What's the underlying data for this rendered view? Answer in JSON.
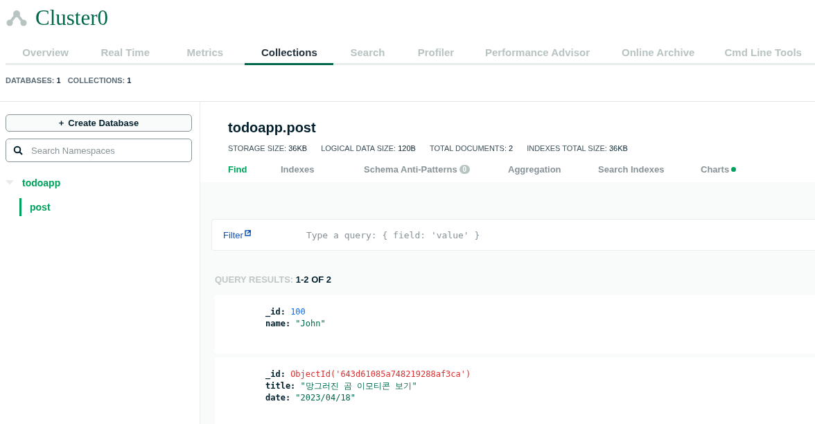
{
  "cluster": {
    "title": "Cluster0"
  },
  "tabs": [
    {
      "label": "Overview",
      "selected": false
    },
    {
      "label": "Real Time",
      "selected": false
    },
    {
      "label": "Metrics",
      "selected": false
    },
    {
      "label": "Collections",
      "selected": true
    },
    {
      "label": "Search",
      "selected": false
    },
    {
      "label": "Profiler",
      "selected": false
    },
    {
      "label": "Performance Advisor",
      "selected": false
    },
    {
      "label": "Online Archive",
      "selected": false
    },
    {
      "label": "Cmd Line Tools",
      "selected": false
    }
  ],
  "counts": [
    {
      "label": "DATABASES:",
      "value": "1"
    },
    {
      "label": "COLLECTIONS:",
      "value": "1"
    }
  ],
  "sidebar": {
    "create_button": {
      "icon": "+",
      "label": "Create Database"
    },
    "search": {
      "placeholder": "Search Namespaces"
    },
    "tree": [
      {
        "label": "todoapp",
        "expanded": true,
        "children": [
          {
            "label": "post",
            "selected": true
          }
        ]
      }
    ]
  },
  "collection": {
    "title": "todoapp.post",
    "stats": [
      {
        "label": "STORAGE SIZE:",
        "value": "36KB"
      },
      {
        "label": "LOGICAL DATA SIZE:",
        "value": "120B"
      },
      {
        "label": "TOTAL DOCUMENTS:",
        "value": "2"
      },
      {
        "label": "INDEXES TOTAL SIZE:",
        "value": "36KB"
      }
    ],
    "tabs": [
      {
        "label": "Find",
        "selected": true
      },
      {
        "label": "Indexes",
        "selected": false
      },
      {
        "label": "Schema Anti-Patterns",
        "selected": false,
        "badge": "0"
      },
      {
        "label": "Aggregation",
        "selected": false
      },
      {
        "label": "Search Indexes",
        "selected": false
      },
      {
        "label": "Charts",
        "selected": false,
        "color": "#00a35c"
      }
    ],
    "filter": {
      "label": "Filter",
      "placeholder": "Type a query: { field: 'value' }"
    },
    "results": {
      "label": "QUERY RESULTS:",
      "value": "1-2 OF 2"
    },
    "documents": [
      {
        "fields": [
          {
            "key": "_id:",
            "value": "100",
            "kind": "number"
          },
          {
            "key": "name:",
            "value": "\"John\"",
            "kind": "string"
          }
        ]
      },
      {
        "fields": [
          {
            "key": "_id:",
            "value": "ObjectId('643d61085a748219288af3ca')",
            "kind": "objectid"
          },
          {
            "key": "title:",
            "value": "\"망그러진 곰 이모티콘 보기\"",
            "kind": "string"
          },
          {
            "key": "date:",
            "value": "\"2023/04/18\"",
            "kind": "string"
          }
        ]
      }
    ]
  }
}
